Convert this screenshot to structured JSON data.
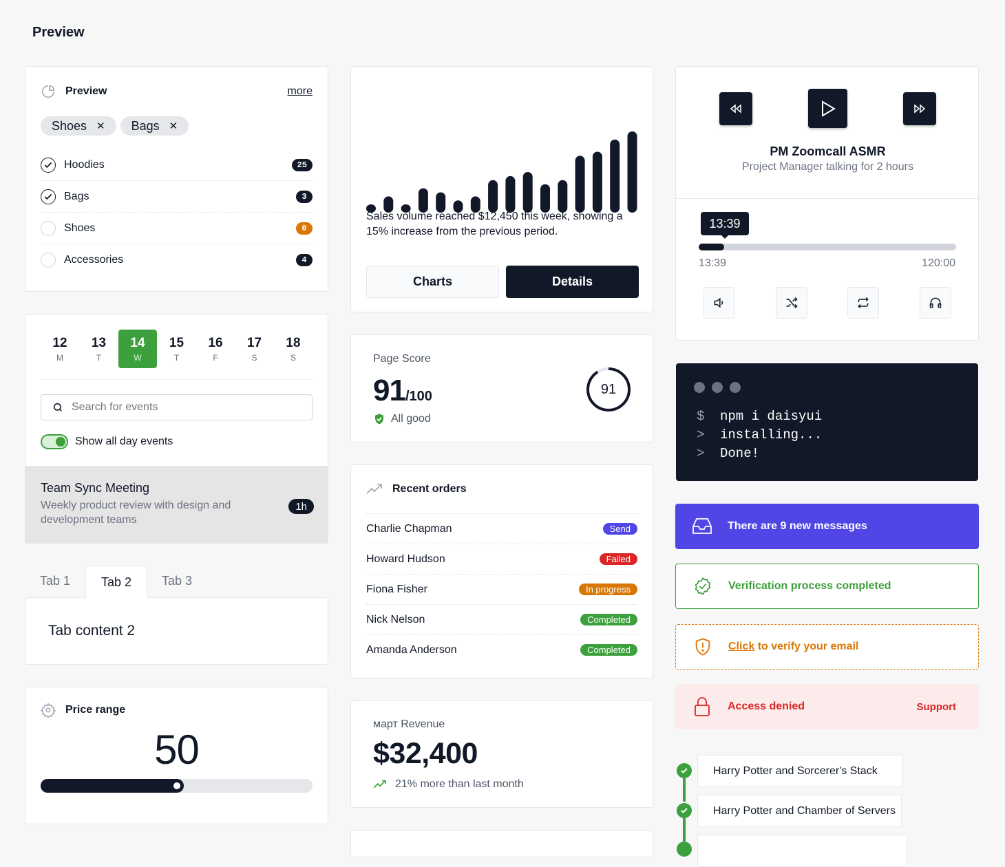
{
  "page": {
    "title": "Preview"
  },
  "filter": {
    "title": "Preview",
    "more": "more",
    "chips": [
      "Shoes",
      "Bags"
    ],
    "items": [
      {
        "label": "Hoodies",
        "count": "25",
        "checked": true
      },
      {
        "label": "Bags",
        "count": "3",
        "checked": true
      },
      {
        "label": "Shoes",
        "count": "0",
        "checked": false
      },
      {
        "label": "Accessories",
        "count": "4",
        "checked": false
      }
    ]
  },
  "calendar": {
    "days": [
      {
        "n": "12",
        "w": "M"
      },
      {
        "n": "13",
        "w": "T"
      },
      {
        "n": "14",
        "w": "W"
      },
      {
        "n": "15",
        "w": "T"
      },
      {
        "n": "16",
        "w": "F"
      },
      {
        "n": "17",
        "w": "S"
      },
      {
        "n": "18",
        "w": "S"
      }
    ],
    "selected_index": 2,
    "search_placeholder": "Search for events",
    "toggle_label": "Show all day events",
    "event": {
      "title": "Team Sync Meeting",
      "desc": "Weekly product review with design and development teams",
      "duration": "1h"
    }
  },
  "tabs": {
    "items": [
      "Tab 1",
      "Tab 2",
      "Tab 3"
    ],
    "active": 1,
    "content": "Tab content 2"
  },
  "price": {
    "title": "Price range",
    "value": "50",
    "fraction": 0.5
  },
  "sales": {
    "bars": [
      1,
      2,
      1,
      3,
      2.5,
      1.5,
      2,
      4,
      4.5,
      5,
      3.5,
      4,
      7,
      7.5,
      9,
      10
    ],
    "text": "Sales volume reached $12,450 this week, showing a 15% increase from the previous period.",
    "btn_charts": "Charts",
    "btn_details": "Details"
  },
  "score": {
    "label": "Page Score",
    "value": "91",
    "suffix": "/100",
    "status": "All good",
    "ring": "91",
    "fraction": 0.91
  },
  "orders": {
    "title": "Recent orders",
    "rows": [
      {
        "name": "Charlie Chapman",
        "status": "Send",
        "color": "#4f46e5"
      },
      {
        "name": "Howard Hudson",
        "status": "Failed",
        "color": "#dc2626"
      },
      {
        "name": "Fiona Fisher",
        "status": "In progress",
        "color": "#d97706"
      },
      {
        "name": "Nick Nelson",
        "status": "Completed",
        "color": "#3ca03c"
      },
      {
        "name": "Amanda Anderson",
        "status": "Completed",
        "color": "#3ca03c"
      }
    ]
  },
  "revenue": {
    "label": "март Revenue",
    "value": "$32,400",
    "change": "21% more than last month"
  },
  "player": {
    "title": "PM Zoomcall ASMR",
    "subtitle": "Project Manager talking for 2 hours",
    "tooltip": "13:39",
    "current": "13:39",
    "total": "120:00",
    "fraction": 0.1
  },
  "terminal": {
    "lines": [
      {
        "prompt": "$",
        "text": "npm i daisyui"
      },
      {
        "prompt": ">",
        "text": "installing..."
      },
      {
        "prompt": ">",
        "text": "Done!"
      }
    ]
  },
  "alerts": {
    "info": "There are 9 new messages",
    "success": "Verification process completed",
    "warning_link": "Click",
    "warning_text": " to verify your email",
    "error": "Access denied",
    "error_action": "Support"
  },
  "timeline": {
    "items": [
      "Harry Potter and Sorcerer's Stack",
      "Harry Potter and Chamber of Servers",
      ""
    ]
  },
  "colors": {
    "accent": "#111827",
    "success": "#3ca03c",
    "info": "#4f46e5",
    "warning": "#d97706",
    "error": "#dc2626"
  }
}
